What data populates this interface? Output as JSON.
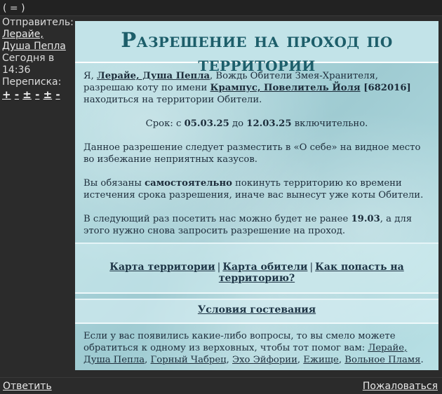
{
  "topbar": {
    "mark": "( = )"
  },
  "sidebar": {
    "sender_label": "Отправитель:",
    "sender_name": "Лерайе, Душа Пепла",
    "date_line1": "Сегодня в",
    "date_line2": "14:36",
    "correspondence_label": "Переписка:",
    "correspondence_controls": [
      "+",
      "-",
      "±",
      "-",
      "±",
      "-"
    ]
  },
  "content": {
    "title": "Разрешение на проход по территории",
    "p1_start": "Я, ",
    "p1_name": "Лерайе, Душа Пепла",
    "p1_mid": ", Вождь Обители Змея-Хранителя, разрешаю коту по имени ",
    "p1_cat": "Крампус, Повелитель Йоля",
    "p1_id": " [682016]",
    "p1_end": " находиться на территории Обители.",
    "term_prefix": "Срок: с ",
    "term_from": "05.03.25",
    "term_mid": " до ",
    "term_to": "12.03.25",
    "term_suffix": " включительно.",
    "p3": "Данное разрешение следует разместить в «О себе» на видное место во избежание неприятных казусов.",
    "p4_start": "Вы обязаны ",
    "p4_bold": "самостоятельно",
    "p4_end": " покинуть территорию ко времени истечения срока разрешения, иначе вас вынесут уже коты Обители.",
    "p5_start": "В следующий раз посетить нас можно будет не ранее ",
    "p5_date": "19.03",
    "p5_end": ", а для этого нужно снова запросить разрешение на проход.",
    "links": {
      "map_territory": "Карта территории",
      "map_abode": "Карта обители",
      "how_to": "Как попасть на территорию?",
      "sep": "|"
    },
    "conditions": "Условия гостевания",
    "bottom_start": "Если у вас появились какие-либо вопросы, то вы смело можете обратиться к одному из верховных, чтобы тот помог вам: ",
    "bottom_names": [
      "Лерайе, Душа Пепла",
      "Горный Чабрец",
      "Эхо Эйфории",
      "Ежище",
      "Вольное Пламя"
    ],
    "comma": ", ",
    "period": "."
  },
  "footer": {
    "reply": "Ответить",
    "report": "Пожаловаться"
  },
  "colors": {
    "title": "#1d5e6a",
    "panel": "#a9d4da",
    "background": "#2b2b2b"
  }
}
